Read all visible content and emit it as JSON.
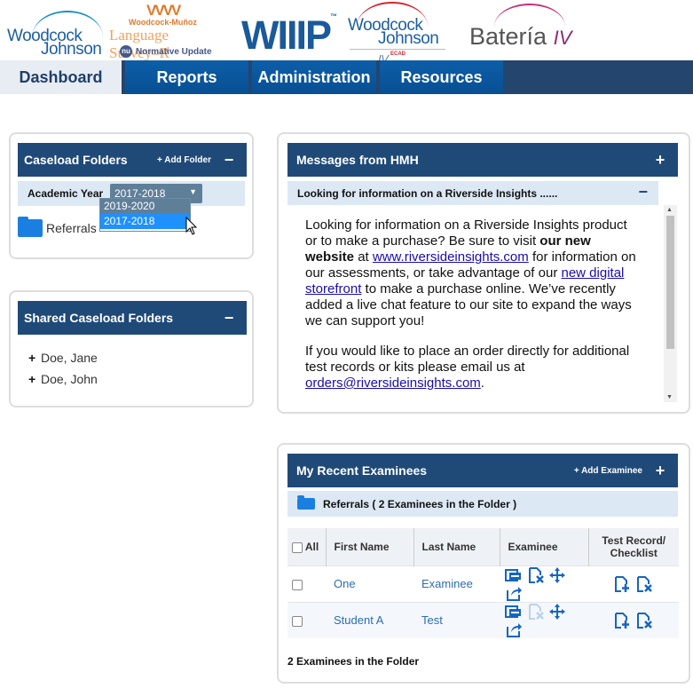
{
  "logos": {
    "wj_top": "Woodcock",
    "wj_bottom": "Johnson",
    "wj_numeral": "IV",
    "wm_line1": "Woodcock-Muñoz",
    "wm_line2": "Language Survey–R",
    "wm_badge": "nu",
    "wm_line3": "Normative Update",
    "wiiip": "WIIIP",
    "wj4_top": "Woodcock",
    "wj4_bottom": "Johnson",
    "wj4_numeral": "IV",
    "wj4_sub": "ECAD",
    "bateria": "Batería",
    "bateria_numeral": "IV"
  },
  "nav": {
    "tabs": [
      "Dashboard",
      "Reports",
      "Administration",
      "Resources"
    ],
    "active": "Dashboard"
  },
  "caseload": {
    "title": "Caseload Folders",
    "add_folder": "+ Add Folder",
    "collapse": "−",
    "academic_year_label": "Academic Year",
    "selected_year": "2017-2018",
    "year_options": [
      "2019-2020",
      "2017-2018"
    ],
    "folder": "Referrals"
  },
  "shared": {
    "title": "Shared Caseload Folders",
    "collapse": "−",
    "items": [
      "Doe, Jane",
      "Doe, John"
    ]
  },
  "messages": {
    "title": "Messages from HMH",
    "expand": "+",
    "subject": "Looking for information on a Riverside Insights ......",
    "collapse": "−",
    "p1_a": "Looking for information on a Riverside Insights product or to make a purchase?  Be sure to visit ",
    "p1_bold": "our new website",
    "p1_b": " at ",
    "p1_link": "www.riversideinsights.com",
    "p1_c": " for information on our assessments, or take advantage of our ",
    "p1_link2": "new digital storefront",
    "p1_d": " to make a purchase online. We’ve recently added a live chat feature to our site to expand the ways we can support you!",
    "p2_a": "If you would like to place an order directly for additional test records or kits please email us at ",
    "p2_link": "orders@riversideinsights.com",
    "p2_b": "."
  },
  "recent": {
    "title": "My Recent Examinees",
    "add_examinee": "+ Add Examinee",
    "expand": "+",
    "folder_label": "Referrals ( 2 Examinees in the Folder )",
    "columns": {
      "all": "All",
      "first": "First Name",
      "last": "Last Name",
      "examinee": "Examinee",
      "record_1": "Test Record/",
      "record_2": "Checklist"
    },
    "rows": [
      {
        "first": "One",
        "last": "Examinee"
      },
      {
        "first": "Student A",
        "last": "Test"
      }
    ],
    "footer": "2 Examinees in the Folder"
  },
  "colors": {
    "header_blue": "#1f4a78",
    "nav_blue": "#0d5ea8",
    "link_blue": "#2c6db0",
    "icon_blue": "#1565c0"
  }
}
